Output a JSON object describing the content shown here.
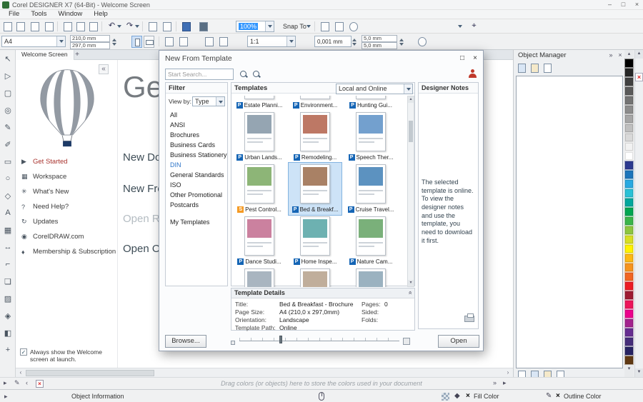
{
  "window": {
    "title": "Corel DESIGNER X7 (64-Bit) - Welcome Screen",
    "menus": [
      "File",
      "Tools",
      "Window",
      "Help"
    ]
  },
  "icons": {
    "minimize": "–",
    "maximize": "□",
    "close": "×",
    "plus": "+",
    "collapse_left": "«",
    "chevrons_right": "»",
    "undo": "↶",
    "redo": "↷",
    "up": "▴",
    "down": "▾",
    "scroll_up": "▲",
    "scroll_down": "▼",
    "back": "‹",
    "forward": "›",
    "flyout": "▸",
    "no_fill": "×",
    "pen": "✎",
    "diamond": "◆",
    "check": "✓"
  },
  "toolbar": {
    "zoom_value": "100%",
    "snap_label": "Snap To"
  },
  "propbar": {
    "page_size": "A4",
    "page_width": "210,0 mm",
    "page_height": "297,0 mm",
    "scale": "1:1",
    "nudge": "0,001 mm",
    "dup_x": "5,0 mm",
    "dup_y": "5,0 mm"
  },
  "toolbox": {
    "tools": [
      {
        "name": "pick",
        "glyph": "↖"
      },
      {
        "name": "shape",
        "glyph": "▷"
      },
      {
        "name": "crop",
        "glyph": "▢"
      },
      {
        "name": "zoom",
        "glyph": "◎"
      },
      {
        "name": "freehand",
        "glyph": "✎"
      },
      {
        "name": "artistic-media",
        "glyph": "✐"
      },
      {
        "name": "rectangle",
        "glyph": "▭"
      },
      {
        "name": "ellipse",
        "glyph": "○"
      },
      {
        "name": "polygon",
        "glyph": "◇"
      },
      {
        "name": "text",
        "glyph": "A"
      },
      {
        "name": "table",
        "glyph": "▦"
      },
      {
        "name": "dimension",
        "glyph": "↔"
      },
      {
        "name": "connector",
        "glyph": "⌐"
      },
      {
        "name": "drop-shadow",
        "glyph": "❏"
      },
      {
        "name": "transparency",
        "glyph": "▨"
      },
      {
        "name": "color-eyedropper",
        "glyph": "◈"
      },
      {
        "name": "interactive-fill",
        "glyph": "◧"
      },
      {
        "name": "add-tools",
        "glyph": "+"
      }
    ]
  },
  "document": {
    "tab_label": "Welcome Screen"
  },
  "welcome": {
    "heading": "Get",
    "links": [
      {
        "label": "New Doc",
        "muted": false
      },
      {
        "label": "New Fro",
        "muted": false
      },
      {
        "label": "Open Rec",
        "muted": true
      },
      {
        "label": "Open Oth",
        "muted": false
      }
    ],
    "sidebar": [
      {
        "label": "Get Started",
        "glyph": "▶",
        "active": true
      },
      {
        "label": "Workspace",
        "glyph": "▦",
        "active": false
      },
      {
        "label": "What's New",
        "glyph": "✳",
        "active": false
      },
      {
        "label": "Need Help?",
        "glyph": "?",
        "active": false
      },
      {
        "label": "Updates",
        "glyph": "↻",
        "active": false
      },
      {
        "label": "CorelDRAW.com",
        "glyph": "◉",
        "active": false
      },
      {
        "label": "Membership & Subscription",
        "glyph": "♦",
        "active": false
      }
    ],
    "checkbox_label": "Always show the Welcome screen at launch.",
    "checkbox_checked": true
  },
  "dialog": {
    "title": "New From Template",
    "search_placeholder": "Start Search...",
    "filter": {
      "header": "Filter",
      "view_by": "View by:",
      "view_value": "Type",
      "items": [
        {
          "label": "All",
          "highlight": false,
          "gap": false
        },
        {
          "label": "ANSI",
          "highlight": false,
          "gap": false
        },
        {
          "label": "Brochures",
          "highlight": false,
          "gap": false
        },
        {
          "label": "Business Cards",
          "highlight": false,
          "gap": false
        },
        {
          "label": "Business Stationery",
          "highlight": false,
          "gap": false
        },
        {
          "label": "DIN",
          "highlight": true,
          "gap": false
        },
        {
          "label": "General Standards",
          "highlight": false,
          "gap": false
        },
        {
          "label": "ISO",
          "highlight": false,
          "gap": false
        },
        {
          "label": "Other Promotional",
          "highlight": false,
          "gap": false
        },
        {
          "label": "Postcards",
          "highlight": false,
          "gap": false
        },
        {
          "label": "My Templates",
          "highlight": false,
          "gap": true
        }
      ]
    },
    "templates": {
      "header": "Templates",
      "source_value": "Local and Online",
      "items": [
        {
          "label": "Estate Planni...",
          "badge": "P",
          "badge_color": "#1565b5",
          "accent": "#9ab6a0",
          "selected": false
        },
        {
          "label": "Environment...",
          "badge": "P",
          "badge_color": "#1565b5",
          "accent": "#6fae7d",
          "selected": false
        },
        {
          "label": "Hunting Gui...",
          "badge": "P",
          "badge_color": "#1565b5",
          "accent": "#8a7a5c",
          "selected": false
        },
        {
          "label": "Urban Lands...",
          "badge": "P",
          "badge_color": "#1565b5",
          "accent": "#8295a5",
          "selected": false
        },
        {
          "label": "Remodeling...",
          "badge": "P",
          "badge_color": "#1565b5",
          "accent": "#b2604a",
          "selected": false
        },
        {
          "label": "Speech Ther...",
          "badge": "P",
          "badge_color": "#1565b5",
          "accent": "#5b8fc6",
          "selected": false
        },
        {
          "label": "Pest Control...",
          "badge": "S",
          "badge_color": "#f59a23",
          "accent": "#79a85f",
          "selected": false
        },
        {
          "label": "Bed & Breakf...",
          "badge": "P",
          "badge_color": "#1565b5",
          "accent": "#9a6b4a",
          "selected": true
        },
        {
          "label": "Cruise Travel...",
          "badge": "P",
          "badge_color": "#1565b5",
          "accent": "#3f7fb5",
          "selected": false
        },
        {
          "label": "Dance Studi...",
          "badge": "P",
          "badge_color": "#1565b5",
          "accent": "#c26b8e",
          "selected": false
        },
        {
          "label": "Home Inspe...",
          "badge": "P",
          "badge_color": "#1565b5",
          "accent": "#54a3a3",
          "selected": false
        },
        {
          "label": "Nature Cam...",
          "badge": "P",
          "badge_color": "#1565b5",
          "accent": "#63a263",
          "selected": false
        },
        {
          "label": "",
          "badge": "",
          "badge_color": "",
          "accent": "#9aa8b5",
          "selected": false
        },
        {
          "label": "",
          "badge": "",
          "badge_color": "",
          "accent": "#b5a08a",
          "selected": false
        },
        {
          "label": "",
          "badge": "",
          "badge_color": "",
          "accent": "#8aa5b5",
          "selected": false
        }
      ]
    },
    "notes": {
      "header": "Designer Notes",
      "text": "The selected template is online. To view the designer notes and use the template, you need to download it first."
    },
    "details": {
      "header": "Template Details",
      "left": [
        {
          "label": "Title:",
          "value": "Bed & Breakfast - Brochure"
        },
        {
          "label": "Page Size:",
          "value": "A4 (210,0 x 297,0mm)"
        },
        {
          "label": "Orientation:",
          "value": "Landscape"
        },
        {
          "label": "Template Path:",
          "value": "Online"
        }
      ],
      "right": [
        {
          "label": "Pages:",
          "value": "0"
        },
        {
          "label": "Sided:",
          "value": ""
        },
        {
          "label": "Folds:",
          "value": ""
        }
      ]
    },
    "browse_label": "Browse...",
    "open_label": "Open"
  },
  "object_manager": {
    "title": "Object Manager"
  },
  "palette": {
    "colors": [
      "#000000",
      "#262626",
      "#404040",
      "#595959",
      "#737373",
      "#8c8c8c",
      "#a6a6a6",
      "#bfbfbf",
      "#d9d9d9",
      "#f2f2f2",
      "#ffffff",
      "#2b3990",
      "#1b75bb",
      "#27a9e1",
      "#29c1d6",
      "#00a79d",
      "#00a651",
      "#39b54a",
      "#8dc63f",
      "#d7df23",
      "#fff200",
      "#fdb913",
      "#f7941e",
      "#f26522",
      "#ed1c24",
      "#9e1b32",
      "#ed145b",
      "#ec008c",
      "#a3238e",
      "#662d91",
      "#452d7a",
      "#262262",
      "#603913"
    ]
  },
  "dock_bar": {
    "hint": "Drag colors (or objects) here to store the colors used in your document"
  },
  "statusbar": {
    "object_info": "Object Information",
    "fill_label": "Fill Color",
    "outline_label": "Outline Color"
  }
}
